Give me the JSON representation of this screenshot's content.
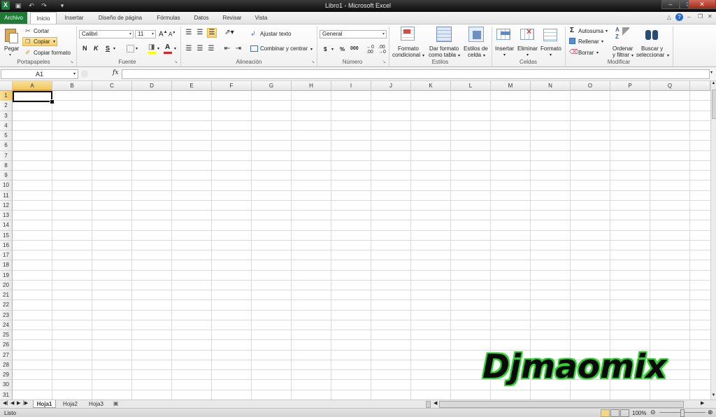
{
  "window": {
    "title": "Libro1 - Microsoft Excel"
  },
  "quick_access": {
    "logo": "X"
  },
  "tabs": [
    {
      "label": "Archivo"
    },
    {
      "label": "Inicio"
    },
    {
      "label": "Insertar"
    },
    {
      "label": "Diseño de página"
    },
    {
      "label": "Fórmulas"
    },
    {
      "label": "Datos"
    },
    {
      "label": "Revisar"
    },
    {
      "label": "Vista"
    }
  ],
  "ribbon": {
    "clipboard": {
      "paste": "Pegar",
      "cut": "Cortar",
      "copy": "Copiar",
      "format_painter": "Copiar formato",
      "label": "Portapapeles"
    },
    "font": {
      "name": "Calibri",
      "size": "11",
      "bold": "N",
      "italic": "K",
      "underline": "S",
      "label": "Fuente"
    },
    "alignment": {
      "wrap": "Ajustar texto",
      "merge": "Combinar y centrar",
      "label": "Alineación"
    },
    "number": {
      "format": "General",
      "currency": "$",
      "percent": "%",
      "thousands": "000",
      "label": "Número"
    },
    "styles": {
      "cond_line1": "Formato",
      "cond_line2": "condicional",
      "table_line1": "Dar formato",
      "table_line2": "como tabla",
      "cell_line1": "Estilos de",
      "cell_line2": "celda",
      "label": "Estilos"
    },
    "cells": {
      "insert": "Insertar",
      "delete": "Eliminar",
      "format": "Formato",
      "label": "Celdas"
    },
    "editing": {
      "autosum": "Autosuma",
      "fill": "Rellenar",
      "clear": "Borrar",
      "sort_line1": "Ordenar",
      "sort_line2": "y filtrar",
      "find_line1": "Buscar y",
      "find_line2": "seleccionar",
      "label": "Modificar"
    }
  },
  "formula_bar": {
    "name_box": "A1",
    "fx": "fx",
    "value": ""
  },
  "grid": {
    "columns": [
      "A",
      "B",
      "C",
      "D",
      "E",
      "F",
      "G",
      "H",
      "I",
      "J",
      "K",
      "L",
      "M",
      "N",
      "O",
      "P",
      "Q"
    ],
    "rows": [
      "1",
      "2",
      "3",
      "4",
      "5",
      "6",
      "7",
      "8",
      "9",
      "10",
      "11",
      "12",
      "13",
      "14",
      "15",
      "16",
      "17",
      "18",
      "19",
      "20",
      "21",
      "22",
      "23",
      "24",
      "25",
      "26",
      "27",
      "28",
      "29",
      "30",
      "31"
    ],
    "selected_cell": "A1"
  },
  "sheets": [
    {
      "label": "Hoja1"
    },
    {
      "label": "Hoja2"
    },
    {
      "label": "Hoja3"
    }
  ],
  "status": {
    "text": "Listo",
    "zoom": "100%"
  },
  "watermark": "Djmaomix",
  "colors": {
    "file_tab": "#1e7a34",
    "selection": "#f2c65d",
    "watermark_outline": "#2fd12f"
  }
}
